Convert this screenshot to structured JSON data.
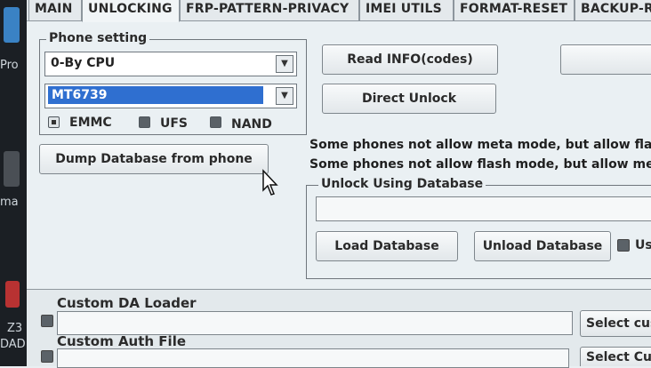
{
  "desktop": {
    "items": [
      "Pro",
      "ma",
      "Z3",
      "DAD"
    ]
  },
  "tabs": [
    {
      "label": "MAIN",
      "active": false
    },
    {
      "label": "UNLOCKING",
      "active": true
    },
    {
      "label": "FRP-PATTERN-PRIVACY",
      "active": false
    },
    {
      "label": "IMEI UTILS",
      "active": false
    },
    {
      "label": "FORMAT-RESET",
      "active": false
    },
    {
      "label": "BACKUP-RE",
      "active": false
    }
  ],
  "phone_setting": {
    "legend": "Phone setting",
    "method": "0-By CPU",
    "cpu": "MT6739",
    "storage_options": [
      {
        "label": "EMMC",
        "selected": true
      },
      {
        "label": "UFS",
        "selected": false
      },
      {
        "label": "NAND",
        "selected": false
      }
    ]
  },
  "buttons": {
    "read_info": "Read INFO(codes)",
    "direct_unlock": "Direct Unlock",
    "dump_database": "Dump Database from phone",
    "load_database": "Load Database",
    "unload_database": "Unload Database"
  },
  "notes": {
    "line1": "Some phones not allow meta mode, but allow flash",
    "line2": "Some phones not allow flash mode, but allow meta"
  },
  "unlock_db": {
    "legend": "Unlock Using Database",
    "checkbox_label": "Us"
  },
  "custom_da": {
    "label": "Custom DA Loader",
    "select_label": "Select cus"
  },
  "custom_auth": {
    "label": "Custom Auth File",
    "select_label": "Select Cus"
  },
  "colors": {
    "selection": "#2f6fd0",
    "window_bg": "#eaf0f3"
  }
}
